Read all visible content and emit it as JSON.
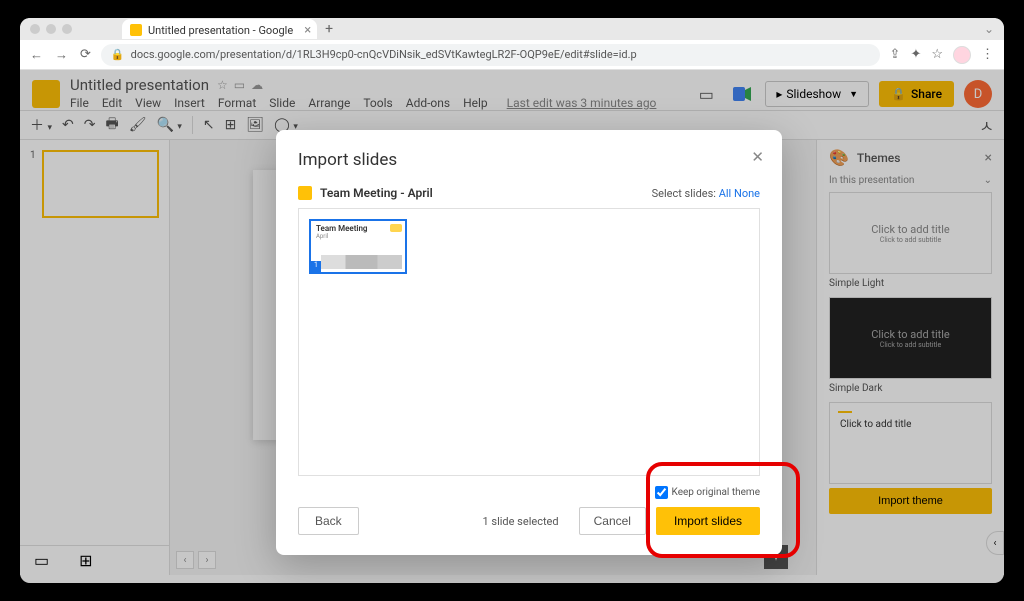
{
  "browser": {
    "tab_title": "Untitled presentation - Google",
    "url": "docs.google.com/presentation/d/1RL3H9cp0-cnQcVDiNsik_edSVtKawtegLR2F-OQP9eE/edit#slide=id.p"
  },
  "header": {
    "doc_title": "Untitled presentation",
    "last_edit": "Last edit was 3 minutes ago",
    "menus": [
      "File",
      "Edit",
      "View",
      "Insert",
      "Format",
      "Slide",
      "Arrange",
      "Tools",
      "Add-ons",
      "Help"
    ],
    "slideshow_label": "Slideshow",
    "share_label": "Share",
    "user_initial": "D"
  },
  "slide": {
    "title_placeholder": "Click to add title",
    "subtitle_placeholder": "Click to add subtitle"
  },
  "themes": {
    "panel_title": "Themes",
    "section_label": "In this presentation",
    "items": [
      {
        "name": "Simple Light",
        "title": "Click to add title",
        "sub": "Click to add subtitle",
        "variant": ""
      },
      {
        "name": "Simple Dark",
        "title": "Click to add title",
        "sub": "Click to add subtitle",
        "variant": "dark"
      },
      {
        "name": "",
        "title": "Click to add title",
        "sub": "",
        "variant": "modern"
      }
    ],
    "import_btn": "Import theme"
  },
  "dialog": {
    "title": "Import slides",
    "source": "Team Meeting - April",
    "select_label": "Select slides:",
    "select_all": "All",
    "select_none": "None",
    "thumb_title": "Team Meeting",
    "thumb_sub": "April",
    "back": "Back",
    "selected_count": "1 slide selected",
    "keep_theme": "Keep original theme",
    "cancel": "Cancel",
    "import": "Import slides"
  }
}
